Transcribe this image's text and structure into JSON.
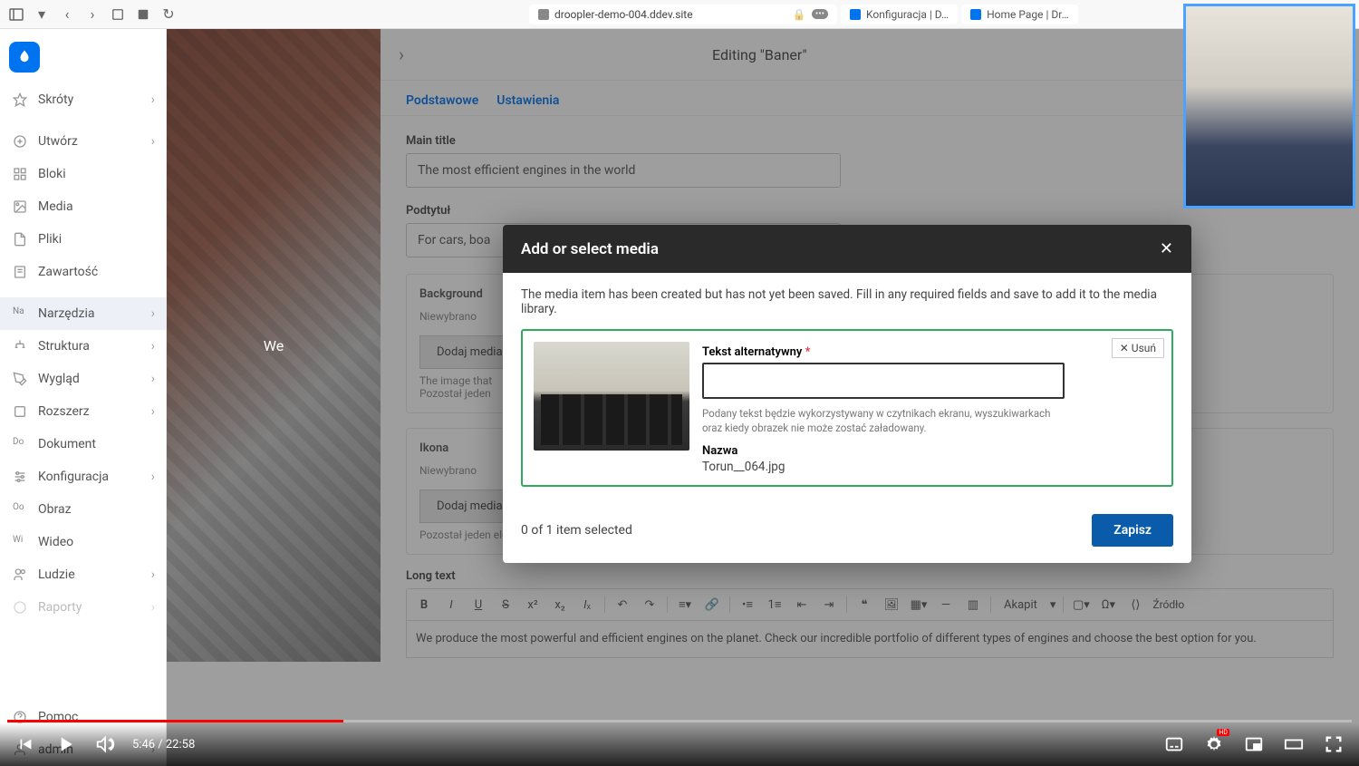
{
  "browser": {
    "url": "droopler-demo-004.ddev.site",
    "tabs": [
      {
        "label": "droopler-demo-004.ddev.site"
      },
      {
        "label": "Konfiguracja | D…"
      },
      {
        "label": "Home Page | Dr…"
      }
    ]
  },
  "sidebar": {
    "items": [
      {
        "label": "Skróty",
        "icon": "star",
        "chevron": true
      },
      {
        "label": "Utwórz",
        "icon": "plus",
        "chevron": true
      },
      {
        "label": "Bloki",
        "icon": "grid",
        "chevron": false
      },
      {
        "label": "Media",
        "icon": "image",
        "chevron": false
      },
      {
        "label": "Pliki",
        "icon": "file",
        "chevron": false
      },
      {
        "label": "Zawartość",
        "icon": "doc",
        "chevron": false
      },
      {
        "label": "Narzędzia",
        "icon": "Na",
        "chevron": true,
        "active": true
      },
      {
        "label": "Struktura",
        "icon": "tree",
        "chevron": true
      },
      {
        "label": "Wygląd",
        "icon": "brush",
        "chevron": true
      },
      {
        "label": "Rozszerz",
        "icon": "puzzle",
        "chevron": true
      },
      {
        "label": "Dokument",
        "icon": "Do",
        "chevron": false
      },
      {
        "label": "Konfiguracja",
        "icon": "sliders",
        "chevron": true
      },
      {
        "label": "Obraz",
        "icon": "Oo",
        "chevron": false
      },
      {
        "label": "Wideo",
        "icon": "Wi",
        "chevron": false
      },
      {
        "label": "Ludzie",
        "icon": "users",
        "chevron": true
      },
      {
        "label": "Raporty",
        "icon": "report",
        "chevron": true
      }
    ],
    "footer": [
      {
        "label": "Pomoc",
        "icon": "help"
      },
      {
        "label": "admin",
        "icon": "user",
        "chevron": true
      }
    ]
  },
  "preview": {
    "center_text": "We"
  },
  "editor": {
    "title": "Editing \"Baner\"",
    "tabs": [
      "Podstawowe",
      "Ustawienia"
    ],
    "main_title_label": "Main title",
    "main_title_value": "The most efficient engines in the world",
    "subtitle_label": "Podtytuł",
    "subtitle_value": "For cars, boa",
    "bg_label": "Background",
    "none_selected": "Niewybrano",
    "add_media": "Dodaj media",
    "bg_help1": "The image that",
    "bg_help2": "Pozostał jeden",
    "icon_label": "Ikona",
    "icon_help": "Pozostał jeden element mediów",
    "long_label": "Long text",
    "long_text": "We produce the most powerful and efficient engines on the planet. Check our incredible portfolio of different types of engines and choose the best option for you.",
    "rte_format": "Akapit",
    "rte_source": "Źródło"
  },
  "modal": {
    "title": "Add or select media",
    "info": "The media item has been created but has not yet been saved. Fill in any required fields and save to add it to the media library.",
    "remove": "Usuń",
    "alt_label": "Tekst alternatywny",
    "alt_value": "",
    "alt_help": "Podany tekst będzie wykorzystywany w czytnikach ekranu, wyszukiwarkach oraz kiedy obrazek nie może zostać załadowany.",
    "name_label": "Nazwa",
    "name_value": "Torun__064.jpg",
    "counter": "0 of 1 item selected",
    "save": "Zapisz"
  },
  "video": {
    "time": "5:46 / 22:58",
    "hd": "HD"
  }
}
